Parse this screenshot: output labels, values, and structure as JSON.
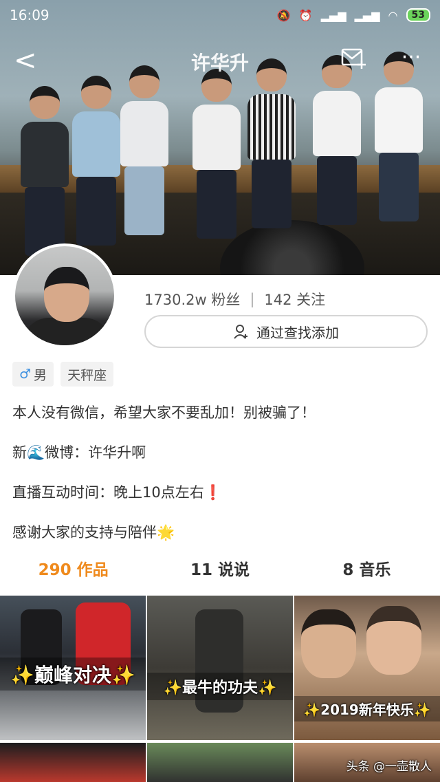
{
  "status_bar": {
    "time": "16:09",
    "battery": "53"
  },
  "nav": {
    "back": "<",
    "title": "许华升",
    "more": "···"
  },
  "profile": {
    "fans": "1730.2w 粉丝",
    "separator": "|",
    "following": "142 关注",
    "find_button": "通过查找添加"
  },
  "tags": [
    {
      "icon": "♂",
      "label": "男"
    },
    {
      "label": "天秤座"
    }
  ],
  "bio": [
    "本人没有微信，希望大家不要乱加！别被骗了！",
    "新🌊微博：许华升啊",
    "直播互动时间：晚上10点左右❗",
    "感谢大家的支持与陪伴🌟"
  ],
  "tabs": [
    {
      "label": "290 作品",
      "active": true
    },
    {
      "label": "11 说说",
      "active": false
    },
    {
      "label": "8 音乐",
      "active": false
    }
  ],
  "grid": [
    {
      "caption": "✨巅峰对决✨"
    },
    {
      "caption": "✨最牛的功夫✨"
    },
    {
      "caption": "✨2019新年快乐✨"
    }
  ],
  "watermark": "头条 @一壶散人",
  "colors": {
    "accent": "#ef8a1d",
    "male": "#3b8fe0"
  }
}
